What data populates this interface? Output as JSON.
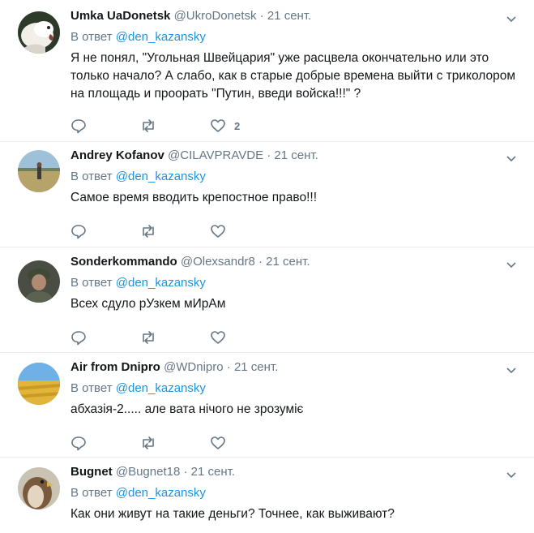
{
  "tweets": [
    {
      "name": "Umka UaDonetsk",
      "handle": "@UkroDonetsk",
      "dot": "·",
      "date": "21 сент.",
      "reply_prefix": "В ответ",
      "mention": "@den_kazansky",
      "text": "Я не понял, \"Угольная Швейцария\" уже расцвела окончательно или это только начало? А слабо, как в старые добрые времена выйти с триколором на площадь и проорать \"Путин, введи войска!!!\" ?",
      "likes": "2"
    },
    {
      "name": "Andrey Kofanov",
      "handle": "@CILAVPRAVDE",
      "dot": "·",
      "date": "21 сент.",
      "reply_prefix": "В ответ",
      "mention": "@den_kazansky",
      "text": "Самое время вводить крепостное право!!!",
      "likes": ""
    },
    {
      "name": "Sonderkommando",
      "handle": "@Olexsandr8",
      "dot": "·",
      "date": "21 сент.",
      "reply_prefix": "В ответ",
      "mention": "@den_kazansky",
      "text": "Всех сдуло рУзкем мИрАм",
      "likes": ""
    },
    {
      "name": "Air from Dnipro",
      "handle": "@WDnipro",
      "dot": "·",
      "date": "21 сент.",
      "reply_prefix": "В ответ",
      "mention": "@den_kazansky",
      "text": "абхазія-2..... але вата нічого не зрозуміє",
      "likes": ""
    },
    {
      "name": "Bugnet",
      "handle": "@Bugnet18",
      "dot": "·",
      "date": "21 сент.",
      "reply_prefix": "В ответ",
      "mention": "@den_kazansky",
      "text": "Как они живут на такие деньги? Точнее, как выживают?",
      "likes": ""
    }
  ],
  "icons": {
    "reply": "reply-icon",
    "retweet": "retweet-icon",
    "like": "heart-icon",
    "menu": "chevron-down-icon"
  },
  "colors": {
    "mention": "#1b95e0",
    "secondary_text": "#657786",
    "divider": "#e6ecf0"
  }
}
